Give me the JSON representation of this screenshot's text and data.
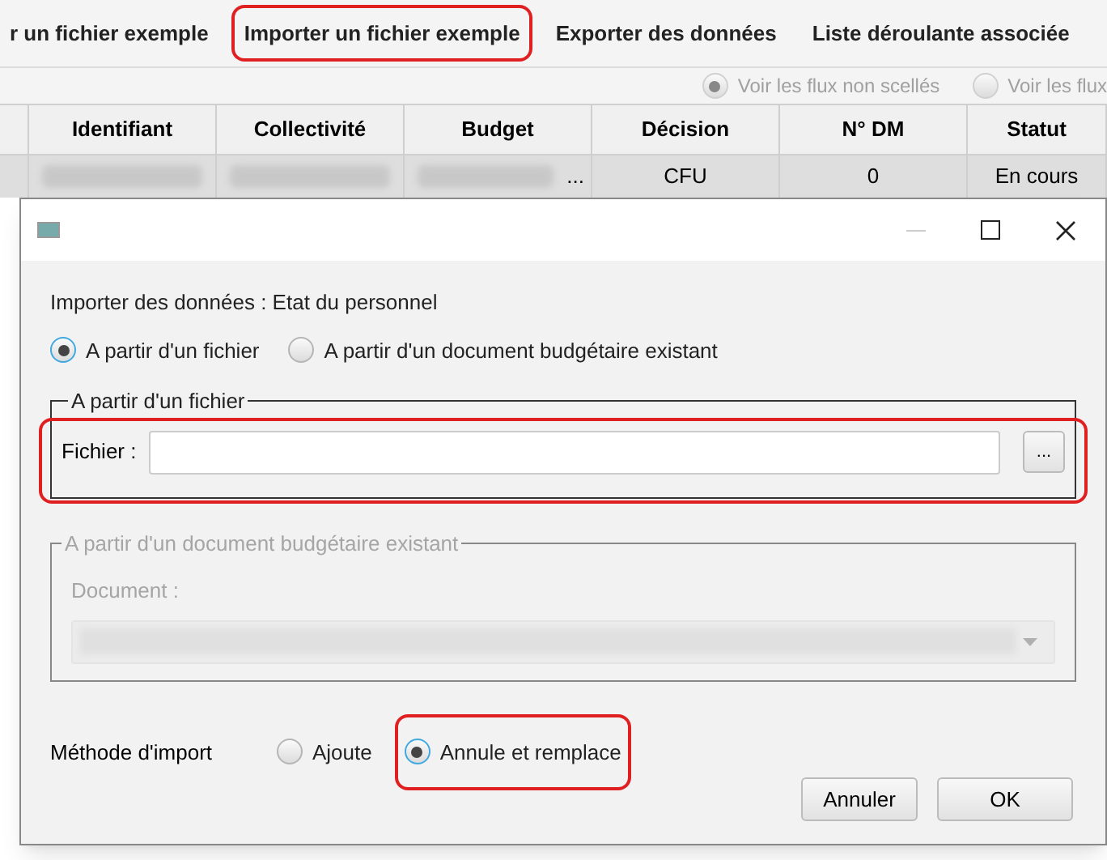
{
  "menu": [
    {
      "label": "r un fichier exemple",
      "highlighted": false
    },
    {
      "label": "Importer un fichier exemple",
      "highlighted": true
    },
    {
      "label": "Exporter des données",
      "highlighted": false
    },
    {
      "label": "Liste déroulante associée",
      "highlighted": false
    }
  ],
  "filters": [
    {
      "label": "Voir les flux non scellés",
      "selected": true
    },
    {
      "label": "Voir les flux",
      "selected": false
    }
  ],
  "table": {
    "columns": [
      "Identifiant",
      "Collectivité",
      "Budget",
      "Décision",
      "N° DM",
      "Statut"
    ],
    "rows": [
      {
        "cells": [
          {
            "kind": "blurred"
          },
          {
            "kind": "blurred"
          },
          {
            "kind": "blurred",
            "text": "..."
          },
          {
            "kind": "text",
            "text": "CFU"
          },
          {
            "kind": "text",
            "text": "0"
          },
          {
            "kind": "text",
            "text": "En cours"
          }
        ]
      }
    ]
  },
  "dialog": {
    "heading": "Importer des données : Etat du personnel",
    "sources": [
      {
        "label": "A partir d'un fichier",
        "selected": true
      },
      {
        "label": "A partir d'un document budgétaire existant",
        "selected": false
      }
    ],
    "file_group": {
      "legend": "A partir d'un fichier",
      "label": "Fichier :",
      "browse": "...",
      "highlighted": true
    },
    "doc_group": {
      "legend": "A partir d'un document budgétaire existant",
      "label": "Document :",
      "disabled": true
    },
    "method": {
      "label": "Méthode d'import",
      "options": [
        {
          "label": "Ajoute",
          "selected": false,
          "highlighted": false
        },
        {
          "label": "Annule et remplace",
          "selected": true,
          "highlighted": true
        }
      ]
    },
    "buttons": [
      "Annuler",
      "OK"
    ]
  }
}
